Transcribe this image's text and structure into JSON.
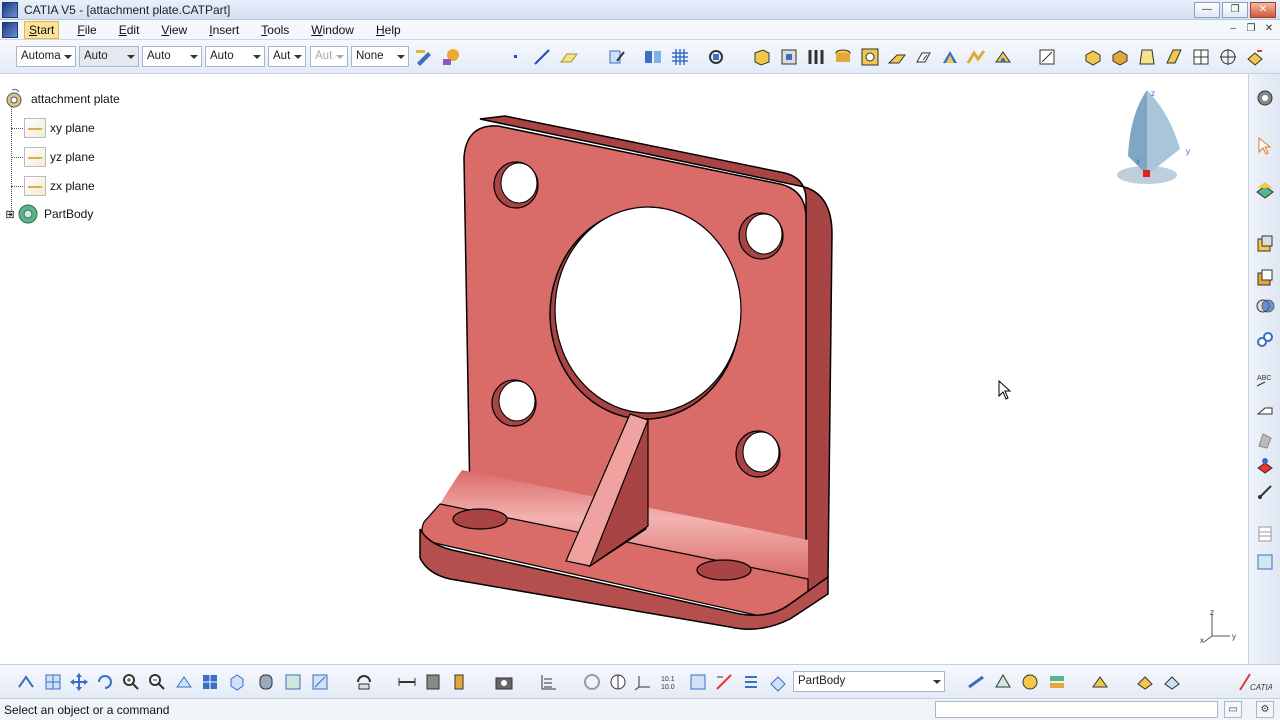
{
  "window": {
    "title": "CATIA V5 - [attachment plate.CATPart]",
    "minimize": "—",
    "maximize": "❐",
    "close": "✕"
  },
  "menu": {
    "items": [
      "Start",
      "File",
      "Edit",
      "View",
      "Insert",
      "Tools",
      "Window",
      "Help"
    ],
    "underline": [
      "S",
      "F",
      "E",
      "V",
      "I",
      "T",
      "W",
      "H"
    ],
    "rest": [
      "tart",
      "ile",
      "dit",
      "iew",
      "nsert",
      "ools",
      "indow",
      "elp"
    ]
  },
  "toolbar": {
    "combo_color": "Automa",
    "combo_transparency": "Auto",
    "combo_thickness": "Auto",
    "combo_linetype": "Auto",
    "combo_point": "Aut",
    "combo_layer_disabled": "Aut",
    "combo_layer": "None"
  },
  "tree": {
    "root": "attachment plate",
    "planes": [
      "xy plane",
      "yz plane",
      "zx plane"
    ],
    "body": "PartBody"
  },
  "bottom_toolbar": {
    "current_body": "PartBody"
  },
  "statusbar": {
    "message": "Select an object or a command",
    "command_value": ""
  },
  "colors": {
    "part_fill": "#d96b69",
    "part_dark": "#a84443",
    "part_light": "#f0a2a0",
    "accent": "#fbe39a"
  },
  "axes": {
    "x": "x",
    "y": "y",
    "z": "z"
  }
}
